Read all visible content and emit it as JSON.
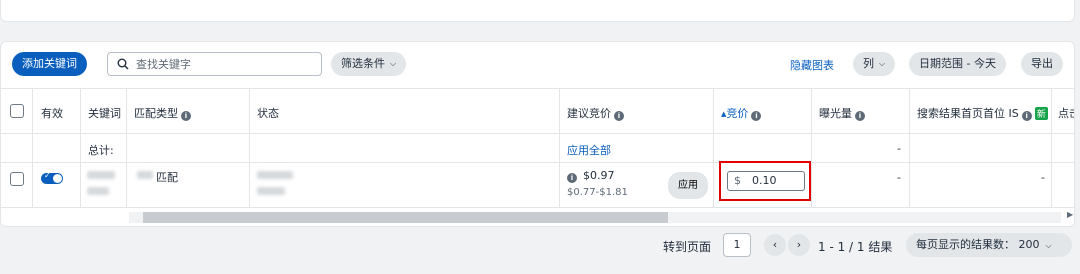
{
  "toolbar": {
    "add_keyword": "添加关键词",
    "search_placeholder": "查找关键字",
    "filter_label": "筛选条件",
    "hide_chart": "隐藏图表",
    "columns_label": "列",
    "date_range": "日期范围 - 今天",
    "export": "导出"
  },
  "table": {
    "headers": {
      "active": "有效",
      "keyword": "关键词",
      "match_type": "匹配类型",
      "status": "状态",
      "suggested_bid": "建议竞价",
      "bid": "竞价",
      "impressions": "曝光量",
      "top_of_search": "搜索结果首页首位 IS",
      "new_badge": "新",
      "clicks_partial": "点击"
    },
    "totals": {
      "label": "总计:",
      "apply_all": "应用全部",
      "impressions": "-"
    },
    "row": {
      "match_type_suffix": "匹配",
      "suggested_bid": "$0.97",
      "suggested_range": "$0.77-$1.81",
      "apply": "应用",
      "bid_currency": "$",
      "bid_value": "0.10",
      "impressions": "-",
      "top_of_search": "-"
    }
  },
  "pagination": {
    "goto_label": "转到页面",
    "page_value": "1",
    "range": "1 - 1 / 1 结果",
    "per_page": "每页显示的结果数： 200"
  },
  "colors": {
    "primary": "#0a5fbe",
    "highlight": "#e50000",
    "new_badge": "#16a34a"
  }
}
